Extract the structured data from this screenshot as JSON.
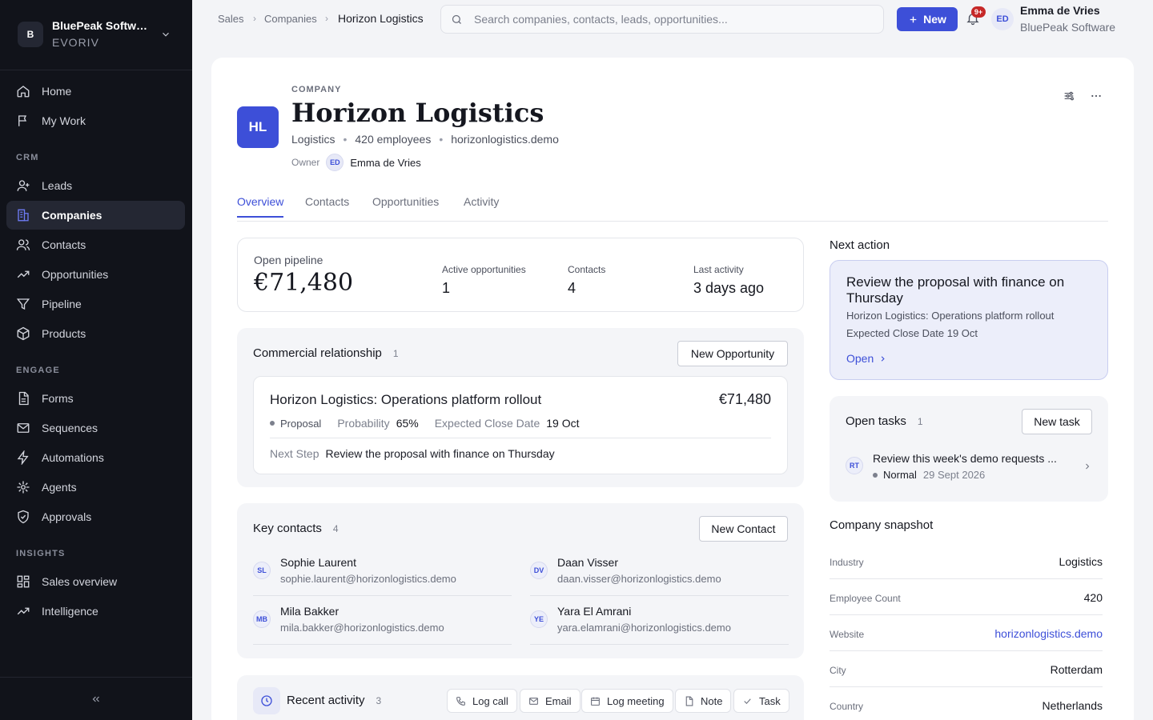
{
  "workspace": {
    "initial": "B",
    "name": "BluePeak Software",
    "sub": "EVORIV"
  },
  "nav": {
    "home": "Home",
    "mywork": "My Work",
    "crm": "CRM",
    "leads": "Leads",
    "companies": "Companies",
    "contacts": "Contacts",
    "opportunities": "Opportunities",
    "pipeline": "Pipeline",
    "products": "Products",
    "engage": "ENGAGE",
    "forms": "Forms",
    "sequences": "Sequences",
    "automations": "Automations",
    "agents": "Agents",
    "approvals": "Approvals",
    "insights": "INSIGHTS",
    "sales_overview": "Sales overview",
    "intelligence": "Intelligence"
  },
  "breadcrumb": {
    "b1": "Sales",
    "b2": "Companies",
    "b3": "Horizon Logistics"
  },
  "search": {
    "placeholder": "Search companies, contacts, leads, opportunities..."
  },
  "topbar": {
    "new_label": "New",
    "notif_count": "9+",
    "user_initials": "ED",
    "user_name": "Emma de Vries",
    "user_org": "BluePeak Software"
  },
  "company": {
    "eyebrow": "COMPANY",
    "initials": "HL",
    "name": "Horizon Logistics",
    "industry": "Logistics",
    "employees": "420 employees",
    "website": "horizonlogistics.demo",
    "owner_label": "Owner",
    "owner_initials": "ED",
    "owner_name": "Emma de Vries"
  },
  "tabs": {
    "overview": "Overview",
    "contacts": "Contacts",
    "opportunities": "Opportunities",
    "activity": "Activity"
  },
  "stats": {
    "pipeline_label": "Open pipeline",
    "pipeline_value": "€71,480",
    "active_label": "Active opportunities",
    "active_value": "1",
    "contacts_label": "Contacts",
    "contacts_value": "4",
    "last_label": "Last activity",
    "last_value": "3 days ago"
  },
  "commercial": {
    "title": "Commercial relationship",
    "count": "1",
    "button": "New Opportunity",
    "opp_name": "Horizon Logistics: Operations platform rollout",
    "opp_amount": "€71,480",
    "stage": "Proposal",
    "prob_label": "Probability",
    "prob_value": "65%",
    "close_label": "Expected Close Date",
    "close_value": "19 Oct",
    "next_label": "Next Step",
    "next_value": "Review the proposal with finance on Thursday"
  },
  "key_contacts": {
    "title": "Key contacts",
    "count": "4",
    "button": "New Contact",
    "items": [
      {
        "initials": "SL",
        "name": "Sophie Laurent",
        "email": "sophie.laurent@horizonlogistics.demo"
      },
      {
        "initials": "DV",
        "name": "Daan Visser",
        "email": "daan.visser@horizonlogistics.demo"
      },
      {
        "initials": "MB",
        "name": "Mila Bakker",
        "email": "mila.bakker@horizonlogistics.demo"
      },
      {
        "initials": "YE",
        "name": "Yara El Amrani",
        "email": "yara.elamrani@horizonlogistics.demo"
      }
    ]
  },
  "recent": {
    "title": "Recent activity",
    "count": "3",
    "log_call": "Log call",
    "email": "Email",
    "log_meeting": "Log meeting",
    "note": "Note",
    "task": "Task"
  },
  "next_action": {
    "title": "Next action",
    "headline": "Review the proposal with finance on Thursday",
    "context": "Horizon Logistics: Operations platform rollout",
    "date": "Expected Close Date 19 Oct",
    "open": "Open"
  },
  "open_tasks": {
    "title": "Open tasks",
    "count": "1",
    "button": "New task",
    "task_initials": "RT",
    "task_title": "Review this week's demo requests ...",
    "priority": "Normal",
    "due": "29 Sept 2026"
  },
  "snapshot": {
    "title": "Company snapshot",
    "rows": [
      {
        "k": "Industry",
        "v": "Logistics"
      },
      {
        "k": "Employee Count",
        "v": "420"
      },
      {
        "k": "Website",
        "v": "horizonlogistics.demo"
      },
      {
        "k": "City",
        "v": "Rotterdam"
      },
      {
        "k": "Country",
        "v": "Netherlands"
      }
    ]
  },
  "colors": {
    "accent": "#3d4fd8",
    "sidebar": "#11131a",
    "badge": "#c62828"
  }
}
